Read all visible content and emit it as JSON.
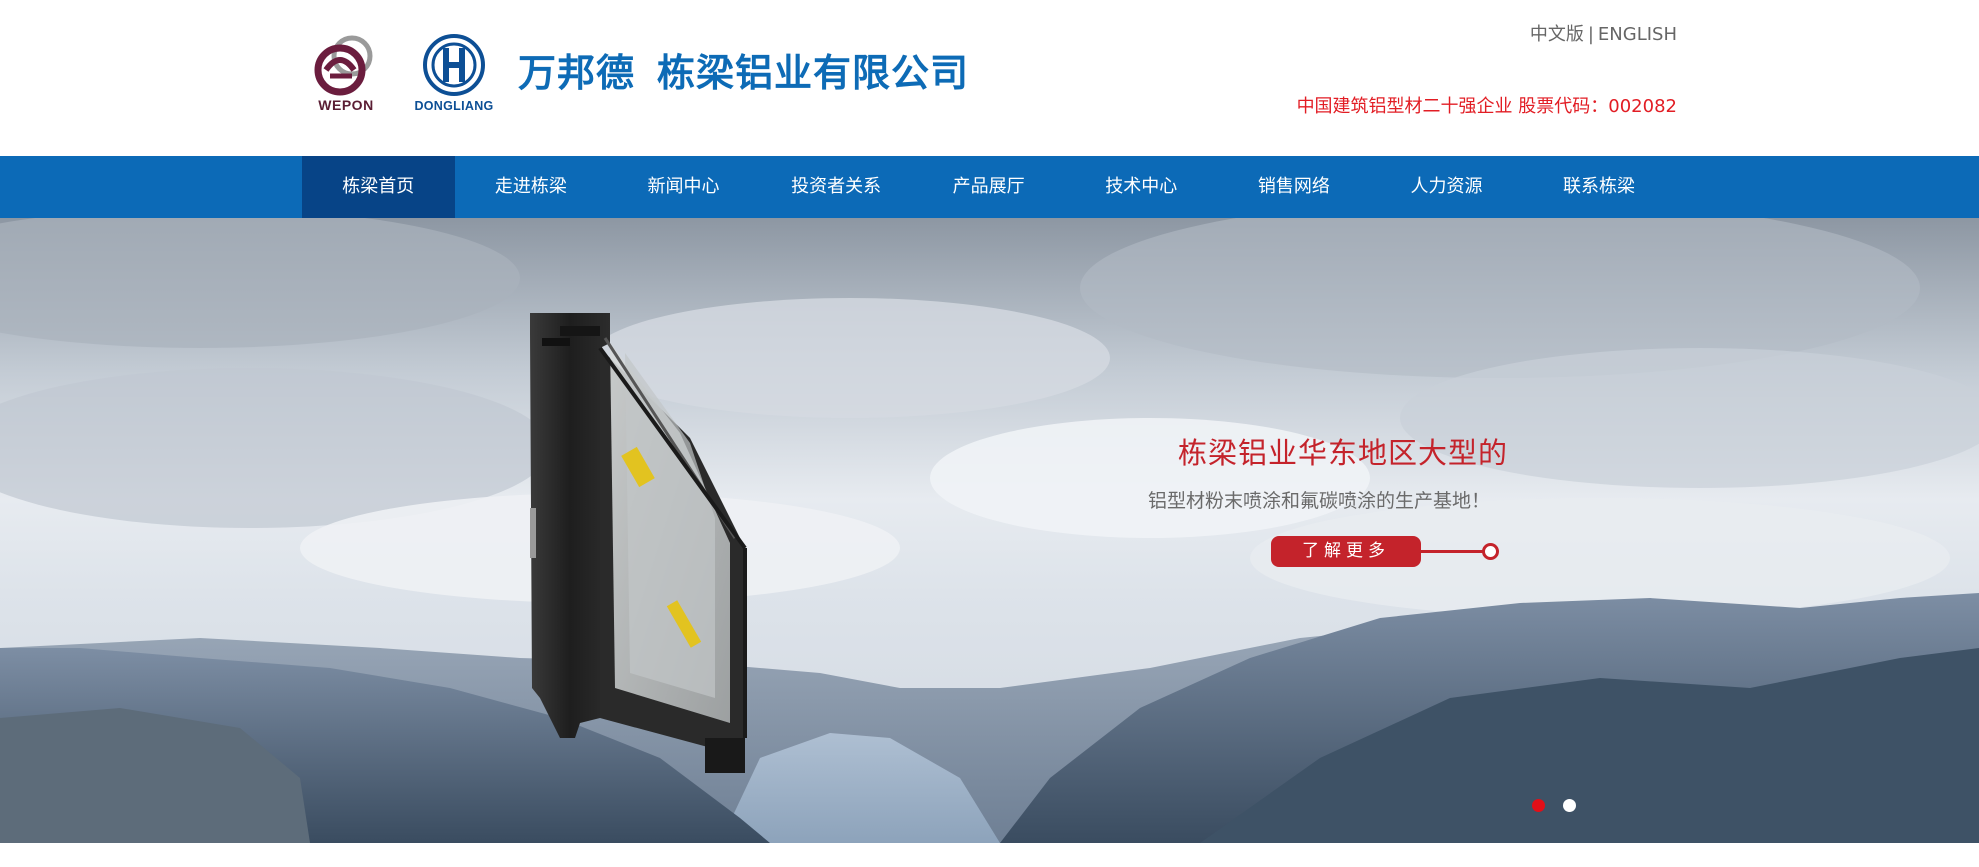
{
  "header": {
    "logo_wepon_text": "WEPON",
    "logo_dongliang_text": "DONGLIANG",
    "company_part1": "万邦德",
    "company_part2": "栋梁铝业有限公司",
    "lang_cn": "中文版",
    "lang_sep": "|",
    "lang_en": "ENGLISH",
    "stock_info": "中国建筑铝型材二十强企业 股票代码：002082"
  },
  "nav": {
    "items": [
      {
        "label": "栋梁首页"
      },
      {
        "label": "走进栋梁"
      },
      {
        "label": "新闻中心"
      },
      {
        "label": "投资者关系"
      },
      {
        "label": "产品展厅"
      },
      {
        "label": "技术中心"
      },
      {
        "label": "销售网络"
      },
      {
        "label": "人力资源"
      },
      {
        "label": "联系栋梁"
      }
    ],
    "active_index": 0
  },
  "banner": {
    "title": "栋梁铝业华东地区大型的",
    "subtitle": "铝型材粉末喷涂和氟碳喷涂的生产基地！",
    "button_label": "了解更多",
    "slide_count": 2,
    "active_slide": 0
  },
  "colors": {
    "nav_bg": "#0c6ab7",
    "nav_active": "#074487",
    "accent_red": "#c4232b",
    "company_blue": "#0d6bb6"
  }
}
